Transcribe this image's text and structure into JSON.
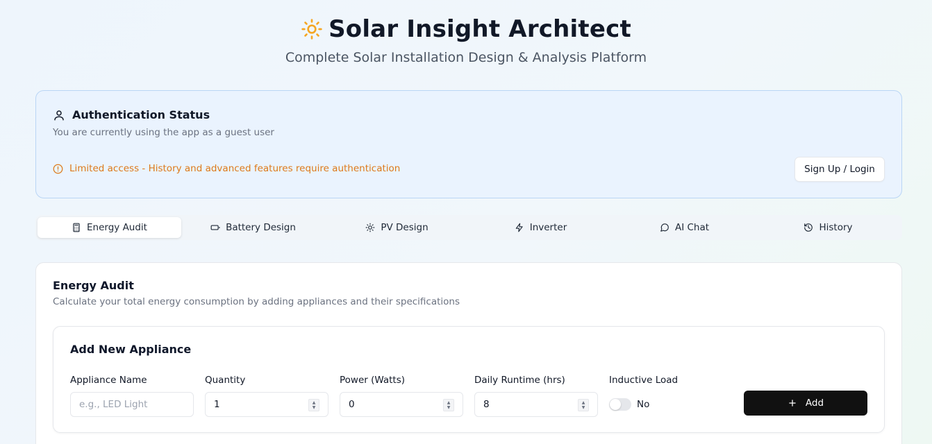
{
  "header": {
    "title": "Solar Insight Architect",
    "subtitle": "Complete Solar Installation Design & Analysis Platform",
    "logo_icon": "sun-icon",
    "logo_color": "#f5a623"
  },
  "auth": {
    "title": "Authentication Status",
    "description": "You are currently using the app as a guest user",
    "warning": "Limited access - History and advanced features require authentication",
    "warning_color": "#dd7a1a",
    "signup_label": "Sign Up / Login"
  },
  "tabs": [
    {
      "label": "Energy Audit",
      "icon": "calculator-icon",
      "active": true
    },
    {
      "label": "Battery Design",
      "icon": "battery-icon",
      "active": false
    },
    {
      "label": "PV Design",
      "icon": "sun-icon",
      "active": false
    },
    {
      "label": "Inverter",
      "icon": "zap-icon",
      "active": false
    },
    {
      "label": "AI Chat",
      "icon": "message-circle-icon",
      "active": false
    },
    {
      "label": "History",
      "icon": "history-icon",
      "active": false
    }
  ],
  "energy_audit": {
    "title": "Energy Audit",
    "description": "Calculate your total energy consumption by adding appliances and their specifications",
    "add_appliance": {
      "title": "Add New Appliance",
      "fields": {
        "name": {
          "label": "Appliance Name",
          "placeholder": "e.g., LED Light",
          "value": ""
        },
        "quantity": {
          "label": "Quantity",
          "value": "1"
        },
        "power": {
          "label": "Power (Watts)",
          "value": "0"
        },
        "runtime": {
          "label": "Daily Runtime (hrs)",
          "value": "8"
        }
      },
      "inductive": {
        "label": "Inductive Load",
        "value_text": "No",
        "enabled": false
      },
      "add_label": "Add"
    }
  }
}
